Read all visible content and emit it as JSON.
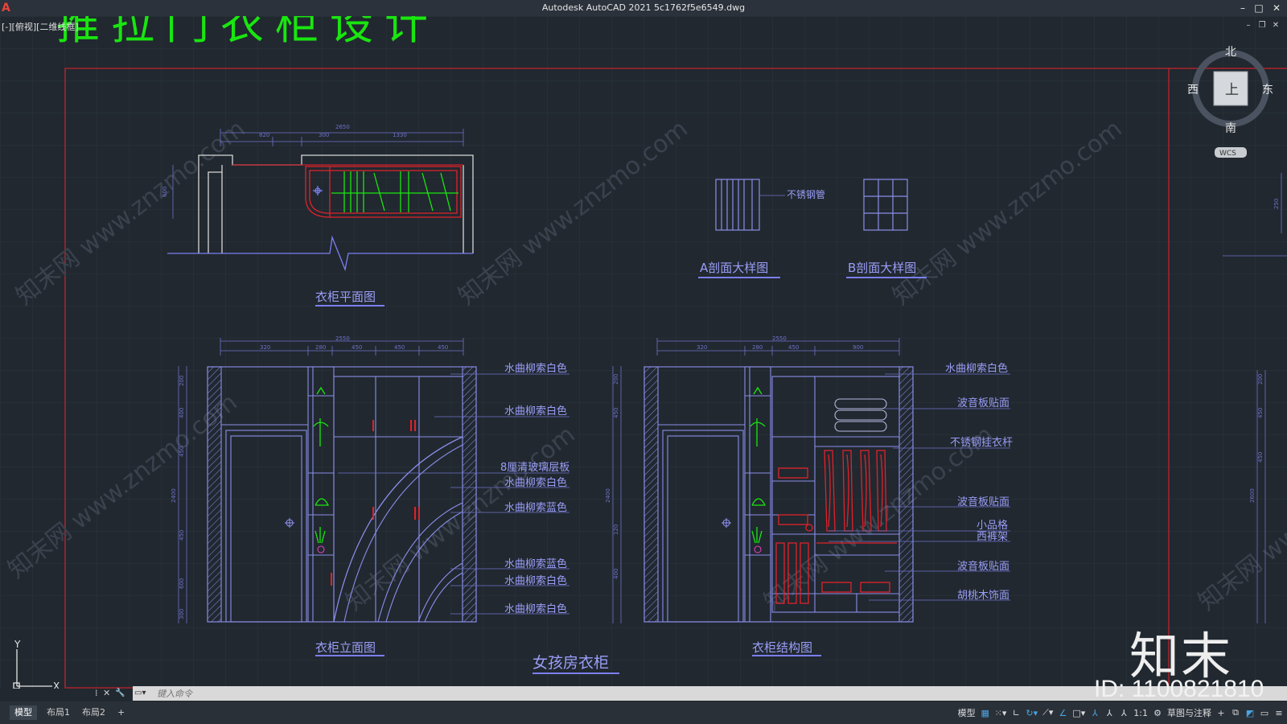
{
  "window": {
    "title": "Autodesk AutoCAD 2021    5c1762f5e6549.dwg",
    "logo": "A",
    "minimize": "–",
    "maximize": "□",
    "close": "✕",
    "doc_min": "–",
    "doc_restore": "❐",
    "doc_close": "✕"
  },
  "viewport": {
    "label": "[-][俯视][二维线框]"
  },
  "drawing": {
    "big_title": "推拉门衣柜设计",
    "plan": {
      "title": "衣柜平面图",
      "dims": [
        "2650",
        "820",
        "300",
        "1330"
      ],
      "side_dim": "600"
    },
    "sections": {
      "a_title": "A剖面大样图",
      "b_title": "B剖面大样图",
      "note": "不锈钢管"
    },
    "elevation": {
      "title": "衣柜立面图",
      "dims_top": [
        "2550",
        "320",
        "280",
        "450",
        "450",
        "450"
      ],
      "dims_left": [
        "200",
        "400",
        "450",
        "2400",
        "450",
        "600",
        "300"
      ],
      "labels": [
        "水曲柳索白色",
        "水曲柳索白色",
        "8厘清玻璃层板",
        "水曲柳索白色",
        "水曲柳索蓝色",
        "水曲柳索蓝色",
        "水曲柳索白色",
        "水曲柳索白色"
      ]
    },
    "structure": {
      "title": "衣柜结构图",
      "dims_top": [
        "2550",
        "320",
        "280",
        "450",
        "900"
      ],
      "dims_left": [
        "200",
        "450",
        "2400",
        "120",
        "400"
      ],
      "labels": [
        "水曲柳索白色",
        "波音板贴面",
        "不锈钢挂衣杆",
        "波音板贴面",
        "小品格",
        "西裤架",
        "波音板贴面",
        "胡桃木饰面"
      ]
    },
    "bottom_title": "女孩房衣柜",
    "watermark": "知末网 www.znzmo.com",
    "right_dims": [
      "200",
      "2600",
      "250",
      "450",
      "450"
    ]
  },
  "viewcube": {
    "north": "北",
    "south": "南",
    "east": "东",
    "west": "西",
    "face": "上",
    "wcs": "WCS"
  },
  "ucs": {
    "x": "X",
    "y": "Y"
  },
  "command": {
    "placeholder": "键入命令",
    "close_glyph": "✕",
    "wrench_glyph": "🔧",
    "grip_glyph": "⁞"
  },
  "tabs": [
    "模型",
    "布局1",
    "布局2",
    "+"
  ],
  "status": {
    "model": "模型",
    "scale": "1:1",
    "workspace": "草图与注释"
  },
  "brand": "知末",
  "id_tag": "ID: 1100821810",
  "colors": {
    "background": "#212830",
    "grid": "#2a323c",
    "line": "#7b7ff0",
    "red": "#e0222a",
    "green": "#19e60f",
    "white": "#d8d8d8"
  }
}
